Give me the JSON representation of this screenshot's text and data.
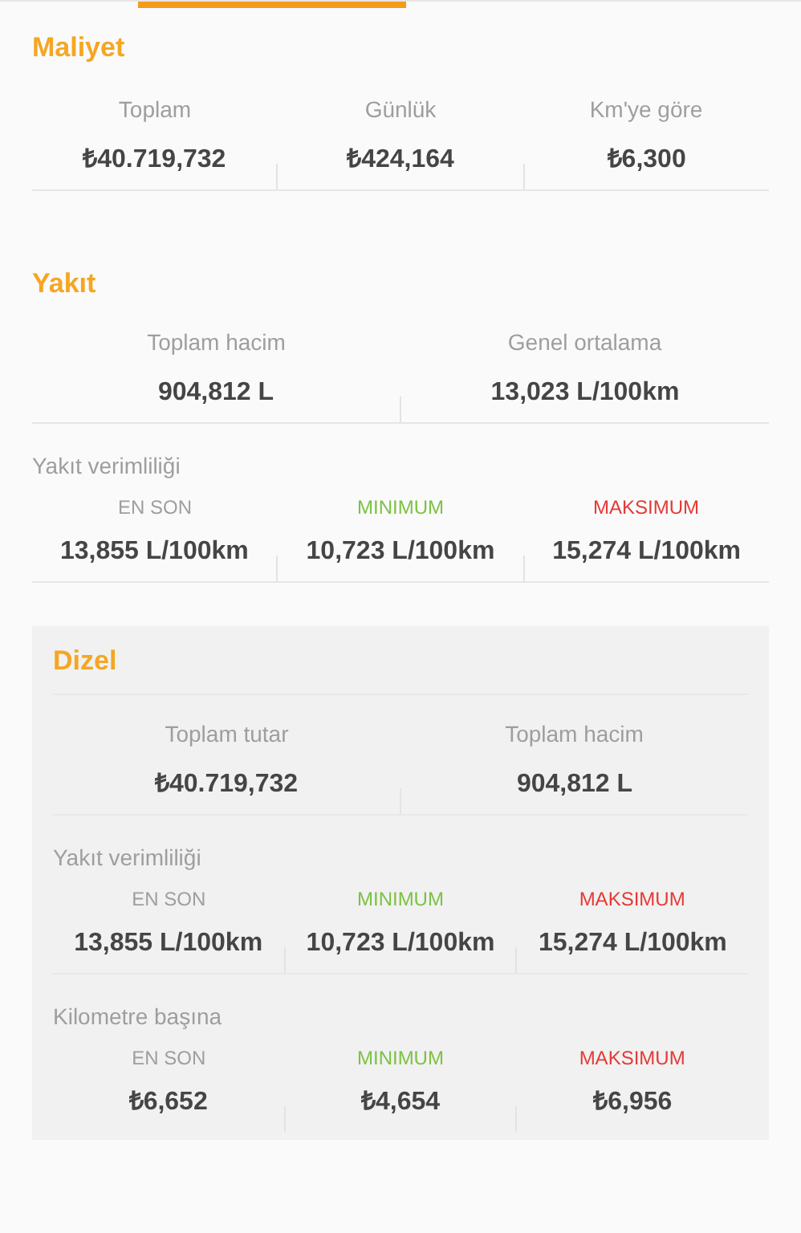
{
  "cost": {
    "title": "Maliyet",
    "items": [
      {
        "label": "Toplam",
        "value": "₺40.719,732"
      },
      {
        "label": "Günlük",
        "value": "₺424,164"
      },
      {
        "label": "Km'ye göre",
        "value": "₺6,300"
      }
    ]
  },
  "fuel": {
    "title": "Yakıt",
    "totals": [
      {
        "label": "Toplam hacim",
        "value": "904,812 L"
      },
      {
        "label": "Genel ortalama",
        "value": "13,023 L/100km"
      }
    ],
    "efficiency": {
      "title": "Yakıt verimliliği",
      "items": [
        {
          "label": "EN SON",
          "color": "#9e9e9e",
          "value": "13,855 L/100km"
        },
        {
          "label": "MINIMUM",
          "color": "#7cc242",
          "value": "10,723 L/100km"
        },
        {
          "label": "MAKSIMUM",
          "color": "#e53935",
          "value": "15,274 L/100km"
        }
      ]
    }
  },
  "diesel": {
    "title": "Dizel",
    "totals": [
      {
        "label": "Toplam tutar",
        "value": "₺40.719,732"
      },
      {
        "label": "Toplam hacim",
        "value": "904,812 L"
      }
    ],
    "efficiency": {
      "title": "Yakıt verimliliği",
      "items": [
        {
          "label": "EN SON",
          "color": "#9e9e9e",
          "value": "13,855 L/100km"
        },
        {
          "label": "MINIMUM",
          "color": "#7cc242",
          "value": "10,723 L/100km"
        },
        {
          "label": "MAKSIMUM",
          "color": "#e53935",
          "value": "15,274 L/100km"
        }
      ]
    },
    "per_km": {
      "title": "Kilometre başına",
      "items": [
        {
          "label": "EN SON",
          "color": "#9e9e9e",
          "value": "₺6,652"
        },
        {
          "label": "MINIMUM",
          "color": "#7cc242",
          "value": "₺4,654"
        },
        {
          "label": "MAKSIMUM",
          "color": "#e53935",
          "value": "₺6,956"
        }
      ]
    }
  }
}
